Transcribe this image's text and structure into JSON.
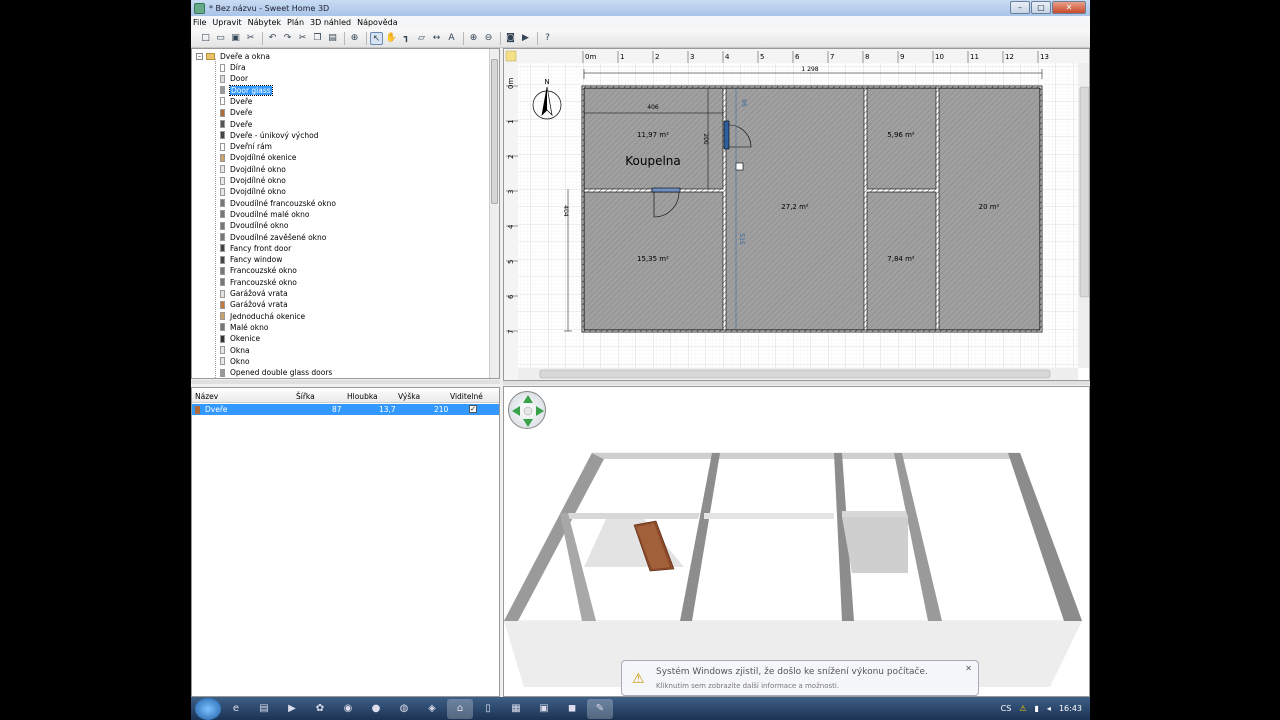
{
  "window": {
    "title": "* Bez názvu - Sweet Home 3D"
  },
  "menu": [
    "File",
    "Upravit",
    "Nábytek",
    "Plán",
    "3D náhled",
    "Nápověda"
  ],
  "toolbar_icons": [
    "new-icon",
    "open-icon",
    "save-icon",
    "cut-icon",
    "undo-icon",
    "redo-icon",
    "scissors-icon",
    "copy-icon",
    "paste-icon",
    "add-furniture-icon",
    "select-icon",
    "pan-icon",
    "create-walls-icon",
    "create-rooms-icon",
    "create-dimensions-icon",
    "add-text-icon",
    "zoom-in-icon",
    "zoom-out-icon",
    "photo-icon",
    "video-icon",
    "help-icon"
  ],
  "catalog": {
    "root": "Dveře a okna",
    "items": [
      {
        "label": "Díra",
        "color": "#ffffff"
      },
      {
        "label": "Door",
        "color": "#dddddd"
      },
      {
        "label": "Door glass",
        "color": "#999999",
        "selected": true
      },
      {
        "label": "Dveře",
        "color": "#ffffff"
      },
      {
        "label": "Dveře",
        "color": "#b06a3a"
      },
      {
        "label": "Dveře",
        "color": "#555555"
      },
      {
        "label": "Dveře - únikový východ",
        "color": "#444444"
      },
      {
        "label": "Dveřní rám",
        "color": "#ffffff"
      },
      {
        "label": "Dvojdílné okenice",
        "color": "#c9a26a"
      },
      {
        "label": "Dvojdílné okno",
        "color": "#e8e8e8"
      },
      {
        "label": "Dvojdílné okno",
        "color": "#e8e8e8"
      },
      {
        "label": "Dvojdílné okno",
        "color": "#e8e8e8"
      },
      {
        "label": "Dvoudílné francouzské okno",
        "color": "#777777"
      },
      {
        "label": "Dvoudílné malé okno",
        "color": "#777777"
      },
      {
        "label": "Dvoudílné okno",
        "color": "#777777"
      },
      {
        "label": "Dvoudílné zavěšené okno",
        "color": "#777777"
      },
      {
        "label": "Fancy front door",
        "color": "#444444"
      },
      {
        "label": "Fancy window",
        "color": "#444444"
      },
      {
        "label": "Francouzské okno",
        "color": "#777777"
      },
      {
        "label": "Francouzské okno",
        "color": "#777777"
      },
      {
        "label": "Garážová vrata",
        "color": "#e0e0e0"
      },
      {
        "label": "Garážová vrata",
        "color": "#c47a3c"
      },
      {
        "label": "Jednoduchá okenice",
        "color": "#c9a26a"
      },
      {
        "label": "Malé okno",
        "color": "#777777"
      },
      {
        "label": "Okenice",
        "color": "#333333"
      },
      {
        "label": "Okna",
        "color": "#e8e8e8"
      },
      {
        "label": "Okno",
        "color": "#e8e8e8"
      },
      {
        "label": "Opened double glass doors",
        "color": "#999999"
      }
    ]
  },
  "furniture_table": {
    "columns": [
      "Název",
      "Šířka",
      "Hloubka",
      "Výška",
      "Viditelné"
    ],
    "rows": [
      {
        "name": "Dveře",
        "width": "87",
        "depth": "13,7",
        "height": "210",
        "visible": "✓"
      }
    ]
  },
  "plan": {
    "ruler_top": [
      "0m",
      "1",
      "2",
      "3",
      "4",
      "5",
      "6",
      "7",
      "8",
      "9",
      "10",
      "11",
      "12",
      "13"
    ],
    "ruler_left": [
      "0m",
      "1",
      "2",
      "3",
      "4",
      "5",
      "6",
      "7"
    ],
    "dimension_total": "1 298",
    "dimension_room": "406",
    "dimension_v1": "200",
    "dimension_v2": "404",
    "dimension_door_v": "515",
    "dimension_door_top": "95",
    "compass_label": "N",
    "rooms": [
      {
        "area": "11,97 m²",
        "label": "Koupelna"
      },
      {
        "area": "15,35 m²"
      },
      {
        "area": "27,2 m²"
      },
      {
        "area": "5,96 m²"
      },
      {
        "area": "7,84 m²"
      },
      {
        "area": "20 m²"
      }
    ]
  },
  "notification": {
    "line1": "Systém Windows zjistil, že došlo ke snížení výkonu počítače.",
    "line2": "Kliknutím sem zobrazíte další informace a možnosti."
  },
  "taskbar": {
    "lang": "CS",
    "time": "16:43"
  }
}
